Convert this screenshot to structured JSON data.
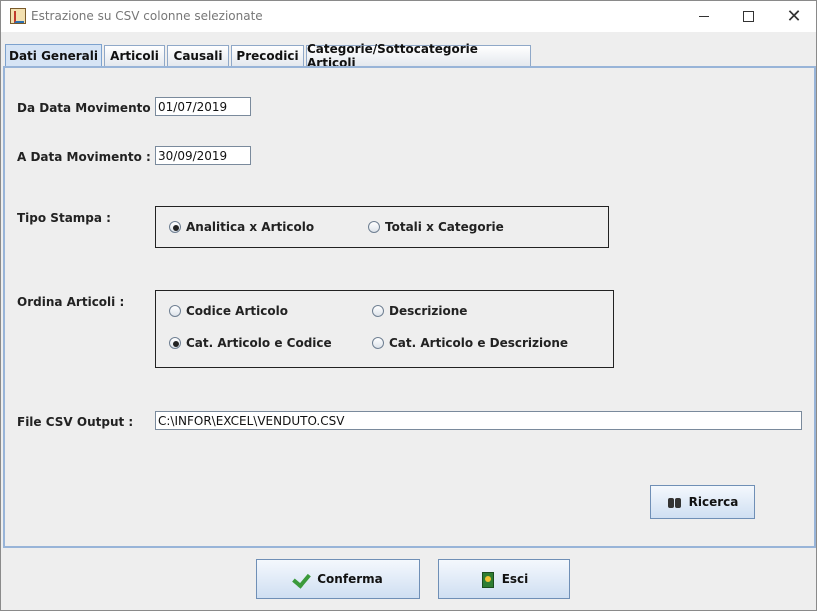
{
  "window": {
    "title": "Estrazione su CSV colonne selezionate"
  },
  "tabs": [
    {
      "label": "Dati Generali"
    },
    {
      "label": "Articoli"
    },
    {
      "label": "Causali"
    },
    {
      "label": "Precodici"
    },
    {
      "label": "Categorie/Sottocategorie Articoli"
    }
  ],
  "form": {
    "da_data_label": "Da Data Movimento :",
    "da_data_value": "01/07/2019",
    "a_data_label": "A  Data Movimento :",
    "a_data_value": "30/09/2019",
    "tipo_stampa_label": "Tipo Stampa :",
    "tipo_stampa_options": [
      {
        "label": "Analitica x Articolo",
        "selected": true
      },
      {
        "label": "Totali x Categorie",
        "selected": false
      }
    ],
    "ordina_label": "Ordina  Articoli :",
    "ordina_options": [
      {
        "label": "Codice Articolo",
        "selected": false
      },
      {
        "label": "Descrizione",
        "selected": false
      },
      {
        "label": "Cat. Articolo e Codice",
        "selected": true
      },
      {
        "label": "Cat. Articolo e Descrizione",
        "selected": false
      }
    ],
    "file_label": "File CSV Output :",
    "file_value": "C:\\INFOR\\EXCEL\\VENDUTO.CSV"
  },
  "buttons": {
    "ricerca": "Ricerca",
    "conferma": "Conferma",
    "esci": "Esci"
  },
  "icons": {
    "ricerca": "binoculars-icon",
    "conferma": "checkmark-icon",
    "esci": "exit-door-icon"
  }
}
